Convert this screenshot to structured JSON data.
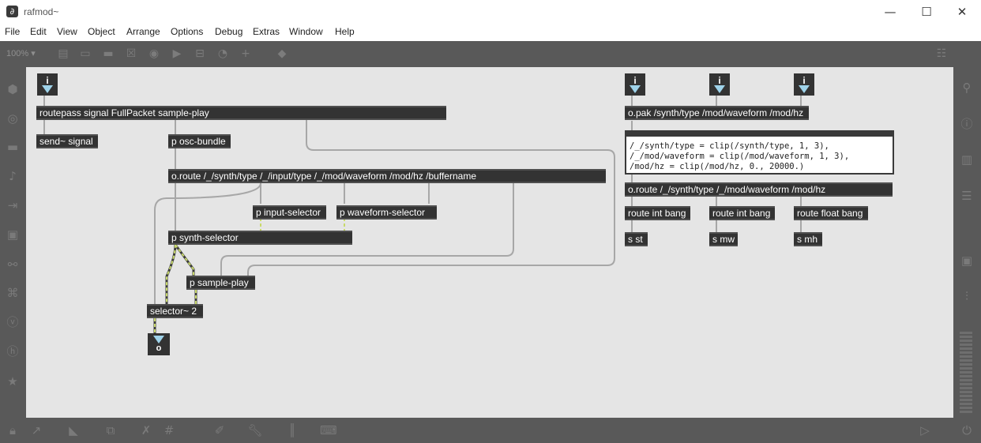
{
  "window": {
    "title": "rafmod~",
    "app_icon": "max-patch-icon",
    "controls": [
      "—",
      "☐",
      "✕"
    ]
  },
  "menu": [
    "File",
    "Edit",
    "View",
    "Object",
    "Arrange",
    "Options",
    "Debug",
    "Extras",
    "Window",
    "Help"
  ],
  "toolbar": {
    "zoom": "100% ▾",
    "icons": [
      "presentation-icon",
      "comment-icon",
      "message-icon",
      "toggle-icon",
      "button-icon",
      "number-icon",
      "slider-icon",
      "dial-icon",
      "add-object-icon",
      "format-icon"
    ]
  },
  "patch": {
    "inlet_label": "i",
    "outlet_label": "o",
    "objects": {
      "routepass": "routepass signal FullPacket sample-play",
      "send_signal": "send~ signal",
      "osc_bundle": "p osc-bundle",
      "oroute_main": "o.route /_/synth/type /_/input/type /_/mod/waveform /mod/hz /buffername",
      "input_selector": "p input-selector",
      "waveform_selector": "p waveform-selector",
      "synth_selector": "p synth-selector",
      "sample_play": "p sample-play",
      "selector": "selector~ 2",
      "opak": "o.pak /synth/type /mod/waveform /mod/hz",
      "oroute_mod": "o.route /_/synth/type /_/mod/waveform /mod/hz",
      "route1": "route int bang",
      "route2": "route int bang",
      "route3": "route float bang",
      "s_st": "s st",
      "s_mw": "s mw",
      "s_mh": "s mh"
    },
    "expr_lines": [
      "/_/synth/type = clip(/synth/type, 1, 3),",
      "/_/mod/waveform = clip(/mod/waveform, 1, 3),",
      "/mod/hz = clip(/mod/hz, 0., 20000.)"
    ]
  },
  "colors": {
    "object_bg": "#333333",
    "canvas_bg": "#e5e5e5",
    "inlet_arrow": "#9fd3ea",
    "signal_patchcord": "#c8d96b"
  }
}
